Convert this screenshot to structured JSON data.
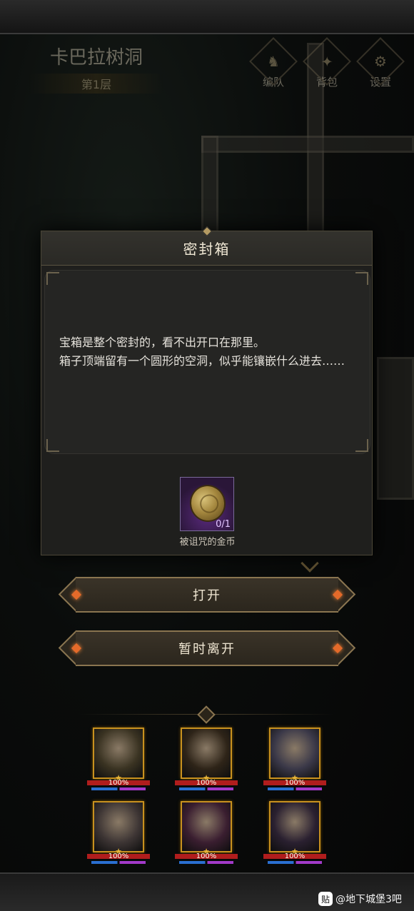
{
  "map": {
    "name": "卡巴拉树洞",
    "floor": "第1层"
  },
  "top_menu": [
    {
      "label": "编队",
      "icon": "helmet-icon",
      "glyph": "♞"
    },
    {
      "label": "背包",
      "icon": "backpack-icon",
      "glyph": "✦"
    },
    {
      "label": "设置",
      "icon": "gear-icon",
      "glyph": "⚙"
    }
  ],
  "dialog": {
    "title": "密封箱",
    "description": "宝箱是整个密封的，看不出开口在那里。\n箱子顶端留有一个圆形的空洞，似乎能镶嵌什么进去……",
    "required_item": {
      "name": "被诅咒的金币",
      "count": "0/1"
    }
  },
  "buttons": {
    "open": "打开",
    "leave": "暂时离开"
  },
  "party": [
    {
      "hp": "100%",
      "color": "#3a3322"
    },
    {
      "hp": "100%",
      "color": "#2e2418"
    },
    {
      "hp": "100%",
      "color": "#3a3848"
    },
    {
      "hp": "100%",
      "color": "#3d3534"
    },
    {
      "hp": "100%",
      "color": "#3a1e30"
    },
    {
      "hp": "100%",
      "color": "#2a2030"
    }
  ],
  "watermark": "@地下城堡3吧",
  "watermark_icon": "贴"
}
